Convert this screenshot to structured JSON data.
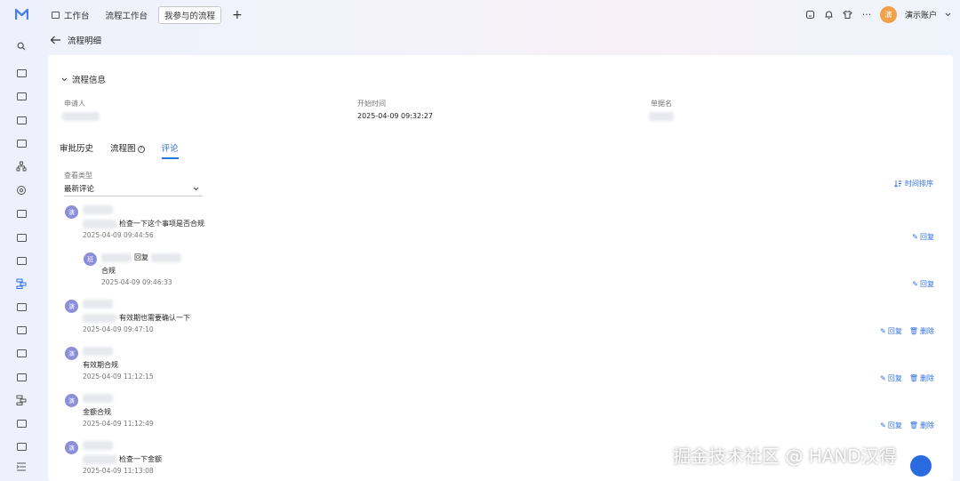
{
  "topbar": {
    "tabs": [
      {
        "label": "工作台",
        "icon": "monitor-icon"
      },
      {
        "label": "流程工作台"
      },
      {
        "label": "我参与的流程",
        "active": true
      }
    ],
    "add_icon": "+",
    "account_avatar": "演",
    "account_name": "演示账户"
  },
  "page": {
    "title": "流程明细"
  },
  "info": {
    "section_title": "流程信息",
    "applicant_label": "申请人",
    "start_time_label": "开始时间",
    "start_time_value": "2025-04-09 09:32:27",
    "doc_label": "单据名"
  },
  "subtabs": [
    {
      "label": "审批历史"
    },
    {
      "label": "流程图"
    },
    {
      "label": "评论",
      "active": true
    }
  ],
  "filter": {
    "label": "查看类型",
    "value": "最新评论"
  },
  "sort_label": "时间排序",
  "comments": [
    {
      "avatar": "演",
      "text": "检查一下这个事项是否合规",
      "time": "2025-04-09 09:44:56",
      "actions": [
        "回复"
      ]
    },
    {
      "avatar": "班",
      "reply_word": "回复",
      "text": "合规",
      "time": "2025-04-09 09:46:33",
      "actions": [
        "回复"
      ]
    },
    {
      "avatar": "演",
      "text": "有效期也需要确认一下",
      "time": "2025-04-09 09:47:10",
      "actions": [
        "回复",
        "删除"
      ]
    },
    {
      "avatar": "演",
      "text": "有效期合规",
      "time": "2025-04-09 11:12:15",
      "actions": [
        "回复",
        "删除"
      ]
    },
    {
      "avatar": "演",
      "text": "金额合规",
      "time": "2025-04-09 11:12:49",
      "actions": [
        "回复",
        "删除"
      ]
    },
    {
      "avatar": "演",
      "text": "检查一下金额",
      "time": "2025-04-09 11:13:08",
      "actions": []
    }
  ],
  "watermark": "掘金技术社区 @ HAND汉得",
  "colors": {
    "accent": "#2f6fe0",
    "avatar_comment": "#8b8fd8",
    "avatar_account": "#f0a14a"
  }
}
